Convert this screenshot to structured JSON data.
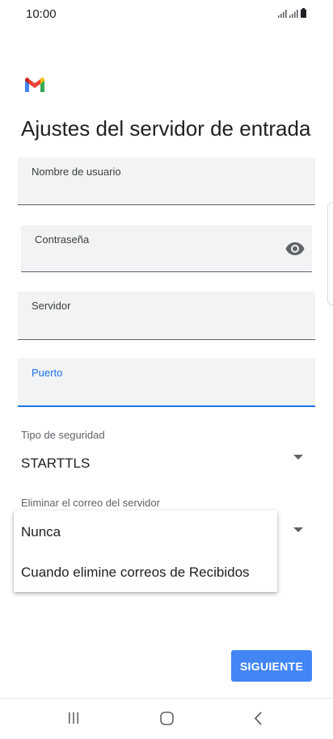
{
  "status_bar": {
    "time": "10:00"
  },
  "app": {
    "logo_icon": "gmail-icon",
    "title": "Ajustes del servidor de entrada"
  },
  "fields": {
    "username": {
      "label": "Nombre de usuario",
      "value": ""
    },
    "password": {
      "label": "Contraseña",
      "value": "",
      "toggle_icon": "eye-icon"
    },
    "server": {
      "label": "Servidor",
      "value": ""
    },
    "port": {
      "label": "Puerto",
      "value": "",
      "focused": true
    }
  },
  "security_type": {
    "label": "Tipo de seguridad",
    "value": "STARTTLS"
  },
  "delete_from_server": {
    "label": "Eliminar el correo del servidor",
    "options": [
      "Nunca",
      "Cuando elimine correos de Recibidos"
    ]
  },
  "actions": {
    "next_label": "SIGUIENTE"
  },
  "colors": {
    "accent": "#1a73e8",
    "button": "#4285f4"
  }
}
